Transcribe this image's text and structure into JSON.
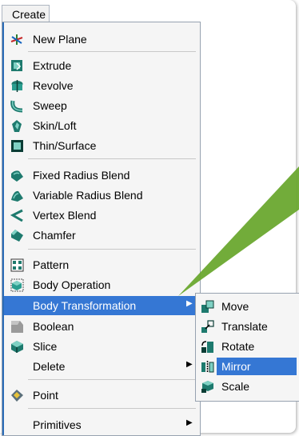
{
  "menubar": {
    "create_label": "Create"
  },
  "menu": {
    "items": [
      {
        "label": "New Plane",
        "icon": "new-plane-icon"
      },
      {
        "label": "Extrude",
        "icon": "extrude-icon"
      },
      {
        "label": "Revolve",
        "icon": "revolve-icon"
      },
      {
        "label": "Sweep",
        "icon": "sweep-icon"
      },
      {
        "label": "Skin/Loft",
        "icon": "skin-loft-icon"
      },
      {
        "label": "Thin/Surface",
        "icon": "thin-surface-icon"
      },
      {
        "label": "Fixed Radius Blend",
        "icon": "fixed-radius-blend-icon"
      },
      {
        "label": "Variable Radius Blend",
        "icon": "variable-radius-blend-icon"
      },
      {
        "label": "Vertex Blend",
        "icon": "vertex-blend-icon"
      },
      {
        "label": "Chamfer",
        "icon": "chamfer-icon"
      },
      {
        "label": "Pattern",
        "icon": "pattern-icon"
      },
      {
        "label": "Body Operation",
        "icon": "body-operation-icon"
      },
      {
        "label": "Body Transformation",
        "icon": ""
      },
      {
        "label": "Boolean",
        "icon": "boolean-icon"
      },
      {
        "label": "Slice",
        "icon": "slice-icon"
      },
      {
        "label": "Delete",
        "icon": ""
      },
      {
        "label": "Point",
        "icon": "point-icon"
      },
      {
        "label": "Primitives",
        "icon": ""
      }
    ],
    "submenu_arrow": "▶"
  },
  "submenu": {
    "items": [
      {
        "label": "Move",
        "icon": "move-icon"
      },
      {
        "label": "Translate",
        "icon": "translate-icon"
      },
      {
        "label": "Rotate",
        "icon": "rotate-icon"
      },
      {
        "label": "Mirror",
        "icon": "mirror-icon"
      },
      {
        "label": "Scale",
        "icon": "scale-icon"
      }
    ]
  },
  "colors": {
    "highlight": "#3577d4",
    "annotation_wedge": "#6aa82f"
  }
}
